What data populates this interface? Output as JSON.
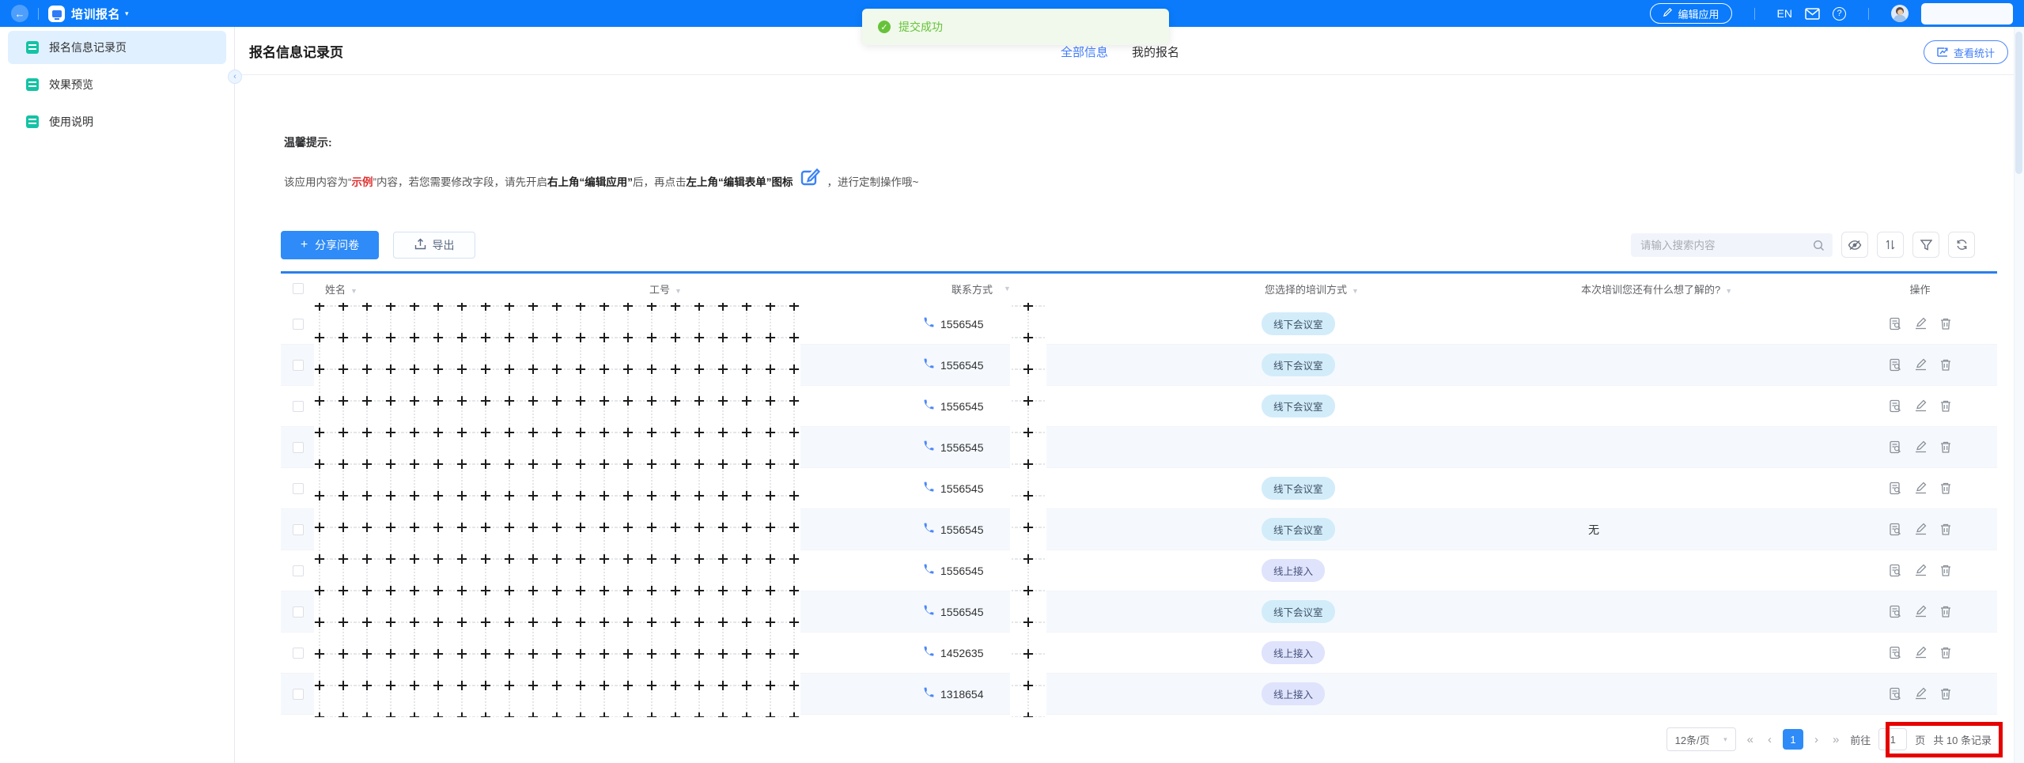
{
  "topbar": {
    "app_name": "培训报名",
    "edit_app_label": "编辑应用",
    "lang_label": "EN"
  },
  "toast": {
    "text": "提交成功"
  },
  "sidebar": {
    "items": [
      {
        "label": "报名信息记录页",
        "active": true
      },
      {
        "label": "效果预览",
        "active": false
      },
      {
        "label": "使用说明",
        "active": false
      }
    ]
  },
  "header": {
    "title": "报名信息记录页",
    "tabs": [
      {
        "label": "全部信息",
        "active": true
      },
      {
        "label": "我的报名",
        "active": false
      }
    ],
    "stats_button": "查看统计"
  },
  "tips": {
    "title": "温馨提示:",
    "seg1": "该应用内容为“",
    "seg_red": "示例",
    "seg2": "”内容，若您需要修改字段，请先开启",
    "seg_bold1": "右上角“编辑应用”",
    "seg3": "后，再点击",
    "seg_bold2": "左上角“编辑表单”图标",
    "seg4": "，进行定制操作哦~"
  },
  "toolbar": {
    "share_button": "分享问卷",
    "export_button": "导出",
    "search_placeholder": "请输入搜索内容"
  },
  "table": {
    "headers": [
      "姓名",
      "工号",
      "联系方式",
      "您选择的培训方式",
      "本次培训您还有什么想了解的?",
      "操作"
    ],
    "rows": [
      {
        "phone": "1556545",
        "training": "线下会议室",
        "type": "offline",
        "note": ""
      },
      {
        "phone": "1556545",
        "training": "线下会议室",
        "type": "offline",
        "note": ""
      },
      {
        "phone": "1556545",
        "training": "线下会议室",
        "type": "offline",
        "note": ""
      },
      {
        "phone": "1556545",
        "training": "",
        "type": "",
        "note": ""
      },
      {
        "phone": "1556545",
        "training": "线下会议室",
        "type": "offline",
        "note": ""
      },
      {
        "phone": "1556545",
        "training": "线下会议室",
        "type": "offline",
        "note": "无"
      },
      {
        "phone": "1556545",
        "training": "线上接入",
        "type": "online",
        "note": ""
      },
      {
        "phone": "1556545",
        "training": "线下会议室",
        "type": "offline",
        "note": ""
      },
      {
        "phone": "1452635",
        "training": "线上接入",
        "type": "online",
        "note": ""
      },
      {
        "phone": "1318654",
        "training": "线上接入",
        "type": "online",
        "note": ""
      }
    ]
  },
  "pagination": {
    "page_size": "12条/页",
    "first": "«",
    "prev": "‹",
    "current_page": "1",
    "next": "›",
    "last": "»",
    "goto_label": "前往",
    "goto_value": "1",
    "page_unit": "页",
    "total_label": "共 10 条记录"
  },
  "icons": {
    "back-icon": "←",
    "dropdown-caret": "▾",
    "success-check": "✓",
    "help-icon": "?",
    "plus-icon": "+",
    "collapse-chevron": "‹"
  },
  "colors": {
    "topbar_blue": "#0b7bfb",
    "primary_blue": "#2e8bf7",
    "link_blue": "#3f7dfb",
    "success_green": "#67c23a",
    "sidebar_icon_teal": "#14c3a5",
    "tag_offline_bg": "#d3ecfa",
    "tag_online_bg": "#dfe3fc",
    "annotation_red": "#e60000"
  }
}
